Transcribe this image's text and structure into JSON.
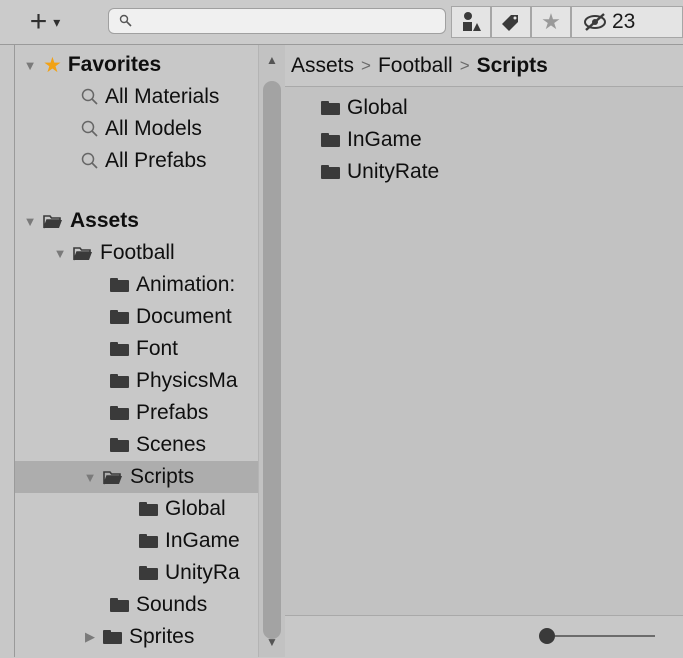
{
  "toolbar": {
    "create_label": "+",
    "create_caret": "▾",
    "search_placeholder": "",
    "hidden_count": "23"
  },
  "favorites": {
    "header": "Favorites",
    "items": [
      "All Materials",
      "All Models",
      "All Prefabs"
    ]
  },
  "tree": {
    "assets_label": "Assets",
    "football_label": "Football",
    "football_children": [
      "Animation:",
      "Document",
      "Font",
      "PhysicsMa",
      "Prefabs",
      "Scenes"
    ],
    "scripts_label": "Scripts",
    "scripts_children": [
      "Global",
      "InGame",
      "UnityRa"
    ],
    "after_scripts": [
      "Sounds",
      "Sprites"
    ]
  },
  "breadcrumb": {
    "items": [
      "Assets",
      "Football",
      "Scripts"
    ],
    "separator": ">"
  },
  "content": {
    "folders": [
      "Global",
      "InGame",
      "UnityRate"
    ]
  },
  "colors": {
    "star": "#f2a215",
    "selected_row": "#adadad",
    "panel": "#c8c8c8"
  }
}
